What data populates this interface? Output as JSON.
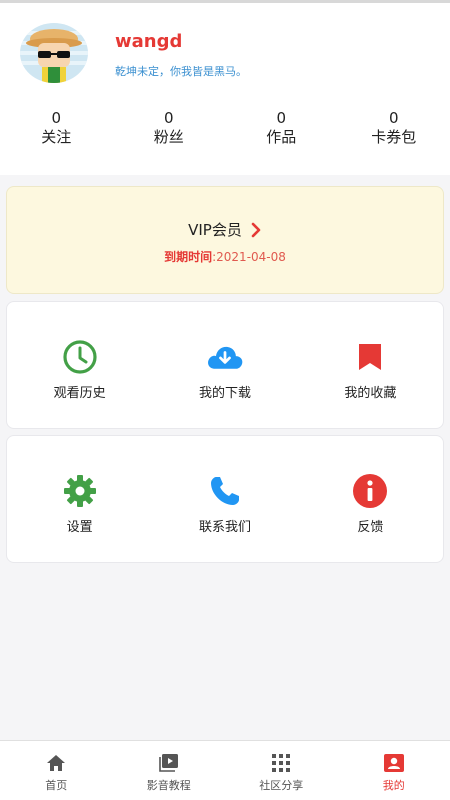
{
  "profile": {
    "username": "wangd",
    "signature": "乾坤未定，你我皆是黑马。"
  },
  "stats": [
    {
      "value": "0",
      "label": "关注"
    },
    {
      "value": "0",
      "label": "粉丝"
    },
    {
      "value": "0",
      "label": "作品"
    },
    {
      "value": "0",
      "label": "卡券包"
    }
  ],
  "vip": {
    "title": "VIP会员",
    "expire_label": "到期时间",
    "expire_sep": ":",
    "expire_date": "2021-04-08"
  },
  "menu_row1": [
    {
      "label": "观看历史",
      "icon": "clock-icon",
      "color": "#43a047"
    },
    {
      "label": "我的下载",
      "icon": "cloud-download-icon",
      "color": "#2196f3"
    },
    {
      "label": "我的收藏",
      "icon": "bookmark-icon",
      "color": "#e53935"
    }
  ],
  "menu_row2": [
    {
      "label": "设置",
      "icon": "gear-icon",
      "color": "#43a047"
    },
    {
      "label": "联系我们",
      "icon": "phone-icon",
      "color": "#2196f3"
    },
    {
      "label": "反馈",
      "icon": "info-icon",
      "color": "#e53935"
    }
  ],
  "tabs": [
    {
      "label": "首页",
      "icon": "home-icon"
    },
    {
      "label": "影音教程",
      "icon": "video-icon"
    },
    {
      "label": "社区分享",
      "icon": "grid-icon"
    },
    {
      "label": "我的",
      "icon": "profile-icon",
      "active": true
    }
  ],
  "colors": {
    "accent": "#e53935",
    "vip_bg": "#fdf8df",
    "link_blue": "#3a8fd0"
  }
}
